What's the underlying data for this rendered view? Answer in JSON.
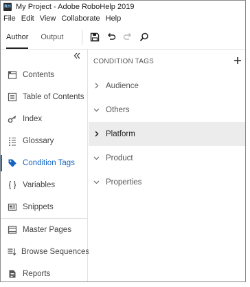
{
  "window": {
    "app_icon_text": "RH",
    "title": "My Project - Adobe RoboHelp 2019"
  },
  "menubar": {
    "items": [
      {
        "label": "File"
      },
      {
        "label": "Edit"
      },
      {
        "label": "View"
      },
      {
        "label": "Collaborate"
      },
      {
        "label": "Help"
      }
    ]
  },
  "tabs": [
    {
      "label": "Author",
      "active": true
    },
    {
      "label": "Output",
      "active": false
    }
  ],
  "toolbar": {
    "icons": [
      "save-icon",
      "undo-icon",
      "redo-icon",
      "search-icon"
    ]
  },
  "left_panel": {
    "collapse_icon": "double-chevron-left-icon",
    "items": [
      {
        "label": "Contents",
        "icon": "contents-icon",
        "active": false
      },
      {
        "label": "Table of Contents",
        "icon": "toc-icon",
        "active": false
      },
      {
        "label": "Index",
        "icon": "key-icon",
        "active": false
      },
      {
        "label": "Glossary",
        "icon": "glossary-icon",
        "active": false
      },
      {
        "label": "Condition Tags",
        "icon": "tag-icon",
        "active": true
      },
      {
        "label": "Variables",
        "icon": "braces-icon",
        "active": false
      },
      {
        "label": "Snippets",
        "icon": "snippet-icon",
        "active": false
      },
      {
        "label": "Master Pages",
        "icon": "master-page-icon",
        "active": false
      },
      {
        "label": "Browse Sequences",
        "icon": "sequence-icon",
        "active": false
      },
      {
        "label": "Reports",
        "icon": "report-icon",
        "active": false
      }
    ]
  },
  "right_panel": {
    "title": "CONDITION TAGS",
    "add_icon": "plus-icon",
    "tags": [
      {
        "label": "Audience",
        "expanded": false,
        "selected": false
      },
      {
        "label": "Others",
        "expanded": true,
        "selected": false
      },
      {
        "label": "Platform",
        "expanded": false,
        "selected": true
      },
      {
        "label": "Product",
        "expanded": true,
        "selected": false
      },
      {
        "label": "Properties",
        "expanded": true,
        "selected": false
      }
    ]
  },
  "colors": {
    "accent": "#1565c0",
    "selected_row": "#ececec",
    "divider": "#e1e1e1"
  }
}
